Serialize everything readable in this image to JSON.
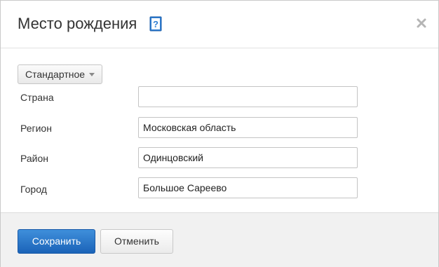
{
  "dialog": {
    "title": "Место рождения",
    "help_icon": "help-book-icon",
    "close_icon": "close-icon"
  },
  "mode_selector": {
    "label": "Стандартное"
  },
  "fields": [
    {
      "label": "Страна",
      "value": ""
    },
    {
      "label": "Регион",
      "value": "Московская область"
    },
    {
      "label": "Район",
      "value": "Одинцовский"
    },
    {
      "label": "Город",
      "value": "Большое Сареево"
    }
  ],
  "footer": {
    "save_label": "Сохранить",
    "cancel_label": "Отменить"
  },
  "colors": {
    "primary_button": "#2a78cc",
    "help_icon": "#2f7fd3",
    "footer_bg": "#f1f1f1"
  }
}
